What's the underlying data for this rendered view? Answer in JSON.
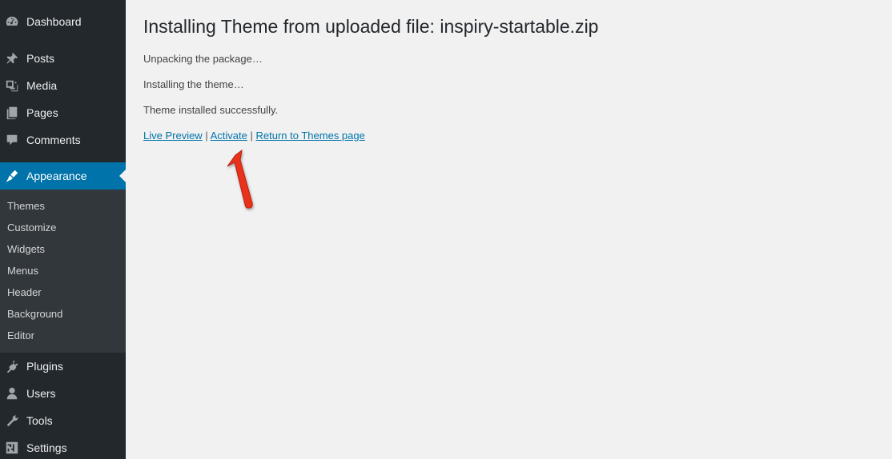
{
  "sidebar": {
    "items": [
      {
        "id": "dashboard",
        "label": "Dashboard",
        "icon": "dashboard-icon"
      },
      {
        "id": "posts",
        "label": "Posts",
        "icon": "pin-icon"
      },
      {
        "id": "media",
        "label": "Media",
        "icon": "media-icon"
      },
      {
        "id": "pages",
        "label": "Pages",
        "icon": "pages-icon"
      },
      {
        "id": "comments",
        "label": "Comments",
        "icon": "comments-icon"
      },
      {
        "id": "appearance",
        "label": "Appearance",
        "icon": "paintbrush-icon",
        "active": true
      },
      {
        "id": "plugins",
        "label": "Plugins",
        "icon": "plugin-icon"
      },
      {
        "id": "users",
        "label": "Users",
        "icon": "user-icon"
      },
      {
        "id": "tools",
        "label": "Tools",
        "icon": "wrench-icon"
      },
      {
        "id": "settings",
        "label": "Settings",
        "icon": "settings-sliders-icon"
      }
    ],
    "submenu": [
      "Themes",
      "Customize",
      "Widgets",
      "Menus",
      "Header",
      "Background",
      "Editor"
    ]
  },
  "main": {
    "title": "Installing Theme from uploaded file: inspiry-startable.zip",
    "messages": [
      "Unpacking the package…",
      "Installing the theme…",
      "Theme installed successfully."
    ],
    "actions": {
      "live_preview": "Live Preview",
      "activate": "Activate",
      "return_themes": "Return to Themes page",
      "separator": "|"
    }
  },
  "colors": {
    "sidebar_bg": "#23282d",
    "submenu_bg": "#32373c",
    "active_bg": "#0073aa",
    "link": "#0073aa",
    "content_bg": "#f1f1f1",
    "arrow": "#e8321f"
  }
}
